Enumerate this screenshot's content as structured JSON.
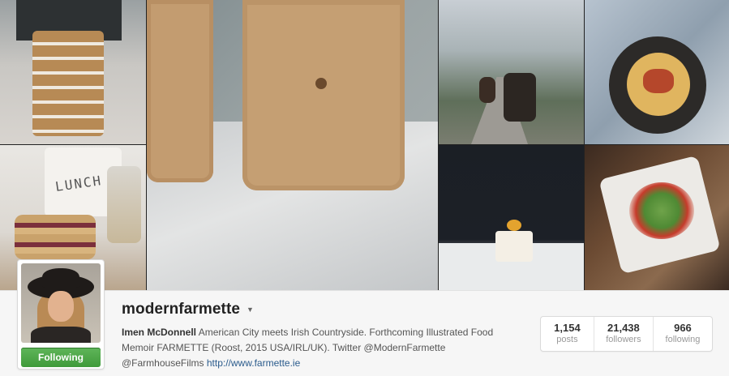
{
  "photo_grid": {
    "tiles": [
      {
        "name": "cookie-stack-photo",
        "overlay_text": "LUNCH"
      },
      {
        "name": "lunch-sandwich-photo",
        "overlay_text": "LUNCH"
      }
    ]
  },
  "profile": {
    "username": "modernfarmette",
    "follow_button_label": "Following",
    "bio": {
      "full_name": "Imen McDonnell",
      "text": "American City meets Irish Countryside. Forthcoming Illustrated Food Memoir FARMETTE (Roost, 2015 USA/IRL/UK). Twitter @ModernFarmette @FarmhouseFilms",
      "link": "http://www.farmette.ie"
    },
    "stats": [
      {
        "value": "1,154",
        "label": "posts"
      },
      {
        "value": "21,438",
        "label": "followers"
      },
      {
        "value": "966",
        "label": "following"
      }
    ]
  },
  "colors": {
    "follow_green": "#4aa645",
    "link_blue": "#2a5b8c",
    "bar_bg": "#f6f6f6"
  },
  "icons": {
    "dropdown": "caret-down-icon"
  }
}
